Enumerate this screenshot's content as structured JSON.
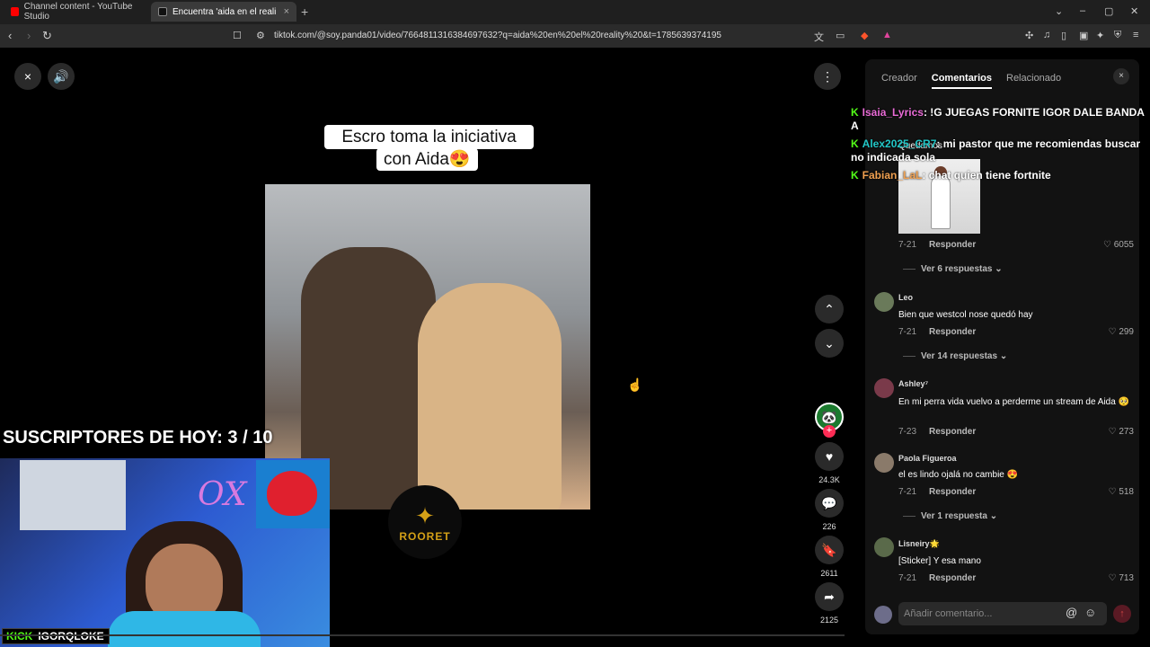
{
  "browser": {
    "tabs": [
      {
        "label": "Channel content - YouTube Studio",
        "color": "#ff0000"
      },
      {
        "label": "Encuentra 'aida en el reality ' en",
        "color": "#000000"
      }
    ],
    "new_tab": "+",
    "url": "tiktok.com/@soy.panda01/video/7664811316384697632?q=aida%20en%20el%20reality%20&t=1785639374195"
  },
  "video": {
    "close_icon": "×",
    "volume_icon": "🔊",
    "more_icon": "⋮",
    "caption_line1": "Escro toma la iniciativa",
    "caption_line2": "con Aida😍",
    "watermark": "ROORET",
    "actions": {
      "likes": "24.3K",
      "comments": "226",
      "saves": "2611",
      "shares": "2125"
    }
  },
  "stream_overlay": {
    "subs_text": "SUSCRIPTORES DE HOY: 3 / 10",
    "kick_brand": "KICK",
    "kick_user": "IGORQLOKE",
    "neon_sign": "OX",
    "chat": [
      {
        "user": "Isaia_Lyrics",
        "text": ": !G JUEGAS FORNITE IGOR DALE BANDA A"
      },
      {
        "user": "Alex2025_CR7",
        "text": ": mi pastor que me recomiendas buscar no indicada sola"
      },
      {
        "user": "Fabian_LaL",
        "text": ": chat quien tiene fortnite"
      }
    ]
  },
  "panel": {
    "tabs": [
      "Creador",
      "Comentarios",
      "Relacionado"
    ],
    "active_tab": "Comentarios",
    "close": "×",
    "first_comment": {
      "text_partial": "Quedamos",
      "date": "7-21",
      "reply": "Responder",
      "likes": "6055",
      "view_replies": "Ver 6 respuestas"
    },
    "comments": [
      {
        "name": "Leo",
        "text": "Bien que westcol nose quedó hay",
        "date": "7-21",
        "reply": "Responder",
        "likes": "299",
        "view_replies": "Ver 14 respuestas"
      },
      {
        "name": "Ashley⁷",
        "text": "En mi perra vida vuelvo a perderme un stream de Aida 🥺",
        "date": "7-23",
        "reply": "Responder",
        "likes": "273"
      },
      {
        "name": "Paola Figueroa",
        "text": "el es lindo ojalá no cambie 😍",
        "date": "7-21",
        "reply": "Responder",
        "likes": "518",
        "view_replies": "Ver 1 respuesta"
      },
      {
        "name": "Lisneiry🌟",
        "text": "[Sticker] Y esa mano",
        "date": "7-21",
        "reply": "Responder",
        "likes": "713"
      }
    ],
    "input_placeholder": "Añadir comentario...",
    "at_icon": "@",
    "emoji_icon": "☺",
    "send_icon": "↑"
  }
}
